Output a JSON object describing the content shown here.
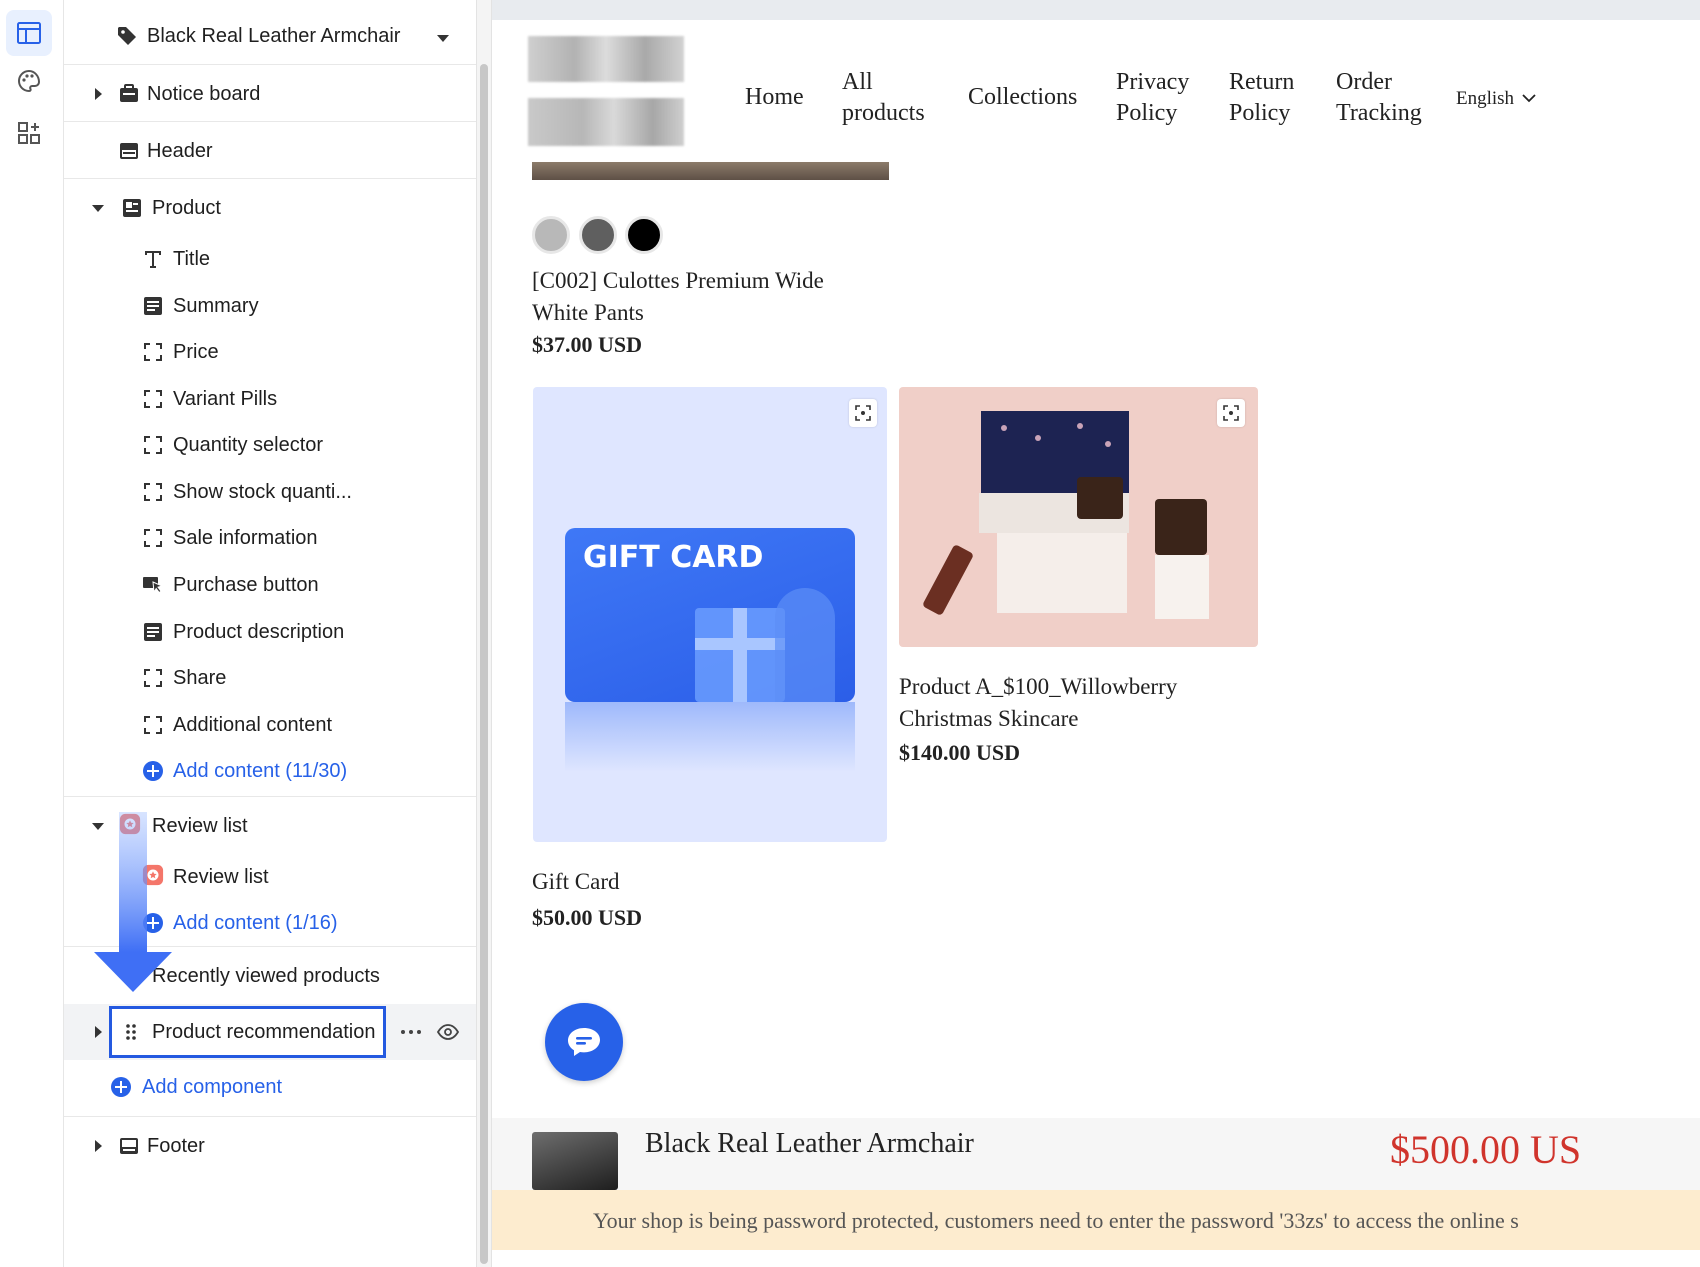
{
  "editor": {
    "selected_product": "Black Real Leather Armchair",
    "sections": {
      "notice_board": "Notice board",
      "header": "Header",
      "product": "Product",
      "review_list": "Review list",
      "recently_viewed": "Recently viewed products",
      "product_recommendation": "Product recommendation",
      "add_component": "Add component",
      "footer": "Footer"
    },
    "product_blocks": [
      {
        "label": "Title",
        "icon": "text-T-icon"
      },
      {
        "label": "Summary",
        "icon": "paragraph-icon"
      },
      {
        "label": "Price",
        "icon": "block-bracket-icon"
      },
      {
        "label": "Variant Pills",
        "icon": "block-bracket-icon"
      },
      {
        "label": "Quantity selector",
        "icon": "block-bracket-icon"
      },
      {
        "label": "Show stock quanti...",
        "icon": "block-bracket-icon"
      },
      {
        "label": "Sale information",
        "icon": "block-bracket-icon"
      },
      {
        "label": "Purchase button",
        "icon": "cursor-click-icon"
      },
      {
        "label": "Product description",
        "icon": "paragraph-icon"
      },
      {
        "label": "Share",
        "icon": "block-bracket-icon"
      },
      {
        "label": "Additional content",
        "icon": "block-bracket-icon"
      }
    ],
    "product_add_content": "Add content (11/30)",
    "review_blocks": [
      {
        "label": "Review list",
        "icon": "review-app-icon"
      }
    ],
    "review_add_content": "Add content (1/16)"
  },
  "preview": {
    "nav": {
      "home": "Home",
      "all_products_1": "All",
      "all_products_2": "products",
      "collections": "Collections",
      "privacy_1": "Privacy",
      "privacy_2": "Policy",
      "return_1": "Return",
      "return_2": "Policy",
      "order_1": "Order",
      "order_2": "Tracking",
      "language": "English"
    },
    "swatches": [
      "#b8b8b8",
      "#5f5f5f",
      "#000000"
    ],
    "products": [
      {
        "name_1": "[C002] Culottes Premium Wide",
        "name_2": "White Pants",
        "price": "$37.00 USD"
      },
      {
        "name_1": "Gift Card",
        "price": "$50.00 USD",
        "image_text": "GIFT CARD"
      },
      {
        "name_1": "Product A_$100_Willowberry",
        "name_2": "Christmas Skincare",
        "price": "$140.00 USD"
      }
    ],
    "sticky": {
      "title": "Black Real Leather Armchair",
      "price": "$500.00 US"
    },
    "banner": "Your shop is being password protected, customers need to enter the password '33zs' to access the online s"
  },
  "colors": {
    "accent": "#2761e8",
    "selection_border": "#2459e0",
    "price_red": "#d0342c",
    "banner_bg": "#fdeccf"
  }
}
